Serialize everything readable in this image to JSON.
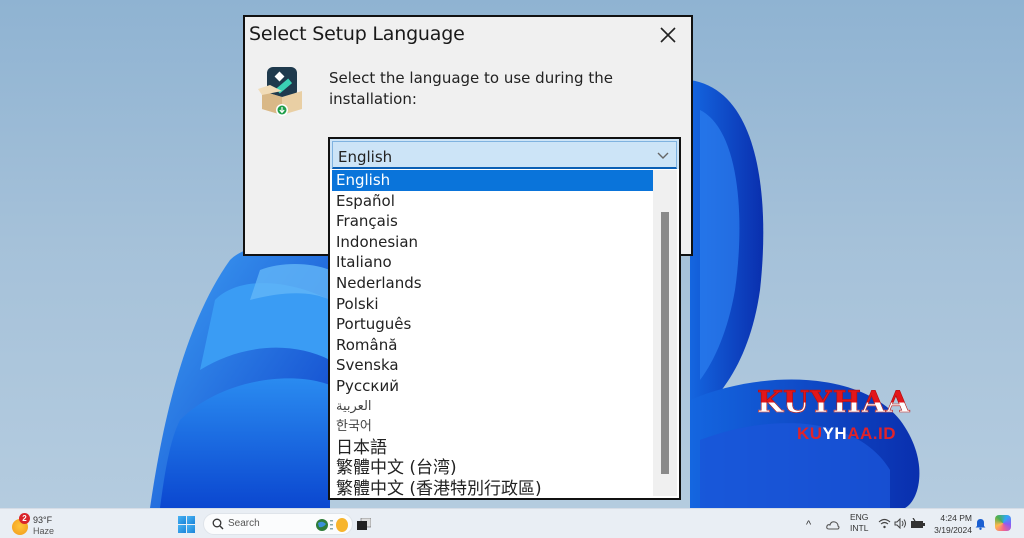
{
  "dialog": {
    "title": "Select Setup Language",
    "close_icon": "close-icon",
    "app_icon": "installer-box-icon",
    "prompt": "Select the language to use during the installation:"
  },
  "language_select": {
    "selected_value": "English",
    "chevron_icon": "chevron-down-icon",
    "options": [
      {
        "label": "English",
        "selected": true
      },
      {
        "label": "Español"
      },
      {
        "label": "Français"
      },
      {
        "label": "Indonesian"
      },
      {
        "label": "Italiano"
      },
      {
        "label": "Nederlands"
      },
      {
        "label": "Polski"
      },
      {
        "label": "Português"
      },
      {
        "label": "Română"
      },
      {
        "label": "Svenska"
      },
      {
        "label": "Русский"
      },
      {
        "label": "العربية"
      },
      {
        "label": "한국어"
      },
      {
        "label": "日本語"
      },
      {
        "label": "繁體中文 (台湾)"
      },
      {
        "label": "繁體中文 (香港特別行政區)"
      }
    ]
  },
  "watermark": {
    "title": "KUYHAA",
    "subtitle_red1": "KU",
    "subtitle_white": "YH",
    "subtitle_red2": "AA.ID"
  },
  "taskbar": {
    "weather": {
      "badge": "2",
      "temperature": "93°F",
      "condition": "Haze"
    },
    "search_placeholder": "Search",
    "language": {
      "line1": "ENG",
      "line2": "INTL"
    },
    "clock": {
      "time": "4:24 PM",
      "date": "3/19/2024"
    },
    "tray_chevron": "^"
  },
  "colors": {
    "selection": "#0a74da",
    "combo_bg": "#cce4f7",
    "dialog_bg": "#f0f0f0",
    "watermark_red": "#e3161b"
  }
}
